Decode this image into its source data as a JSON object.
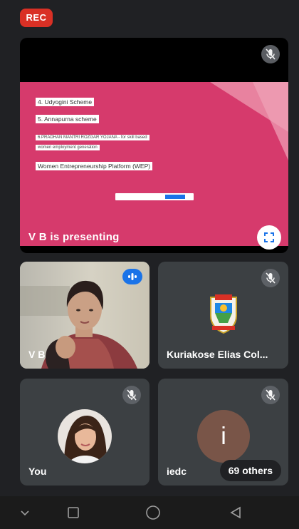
{
  "status": {
    "rec_label": "REC"
  },
  "presentation": {
    "presenter_label": "V B is presenting",
    "slide": {
      "lines": [
        "4. Udyogini Scheme",
        "5. Annapurna scheme",
        "6.PRADHAN MANTRI ROZGAR YOJANA - for skill based",
        "women employment generation",
        "Women Entrepreneurship Platform (WEP)"
      ]
    }
  },
  "participants": {
    "vb": {
      "name": "V B"
    },
    "kuriakose": {
      "name": "Kuriakose Elias Col..."
    },
    "you": {
      "name": "You"
    },
    "iedc": {
      "name": "iedc",
      "avatar_letter": "i",
      "others_label": "69 others"
    }
  },
  "colors": {
    "rec": "#d93025",
    "slide_bg": "#d63a6c",
    "speaking": "#1a73e8",
    "avatar_i": "#795548",
    "tile_bg": "#3c4043"
  },
  "icons": {
    "mic_off": "mic-off-icon",
    "fullscreen": "fullscreen-icon",
    "speaking": "speaking-indicator-icon",
    "nav_down": "chevron-down-icon",
    "nav_recent": "square-icon",
    "nav_home": "circle-icon",
    "nav_back": "triangle-back-icon"
  }
}
